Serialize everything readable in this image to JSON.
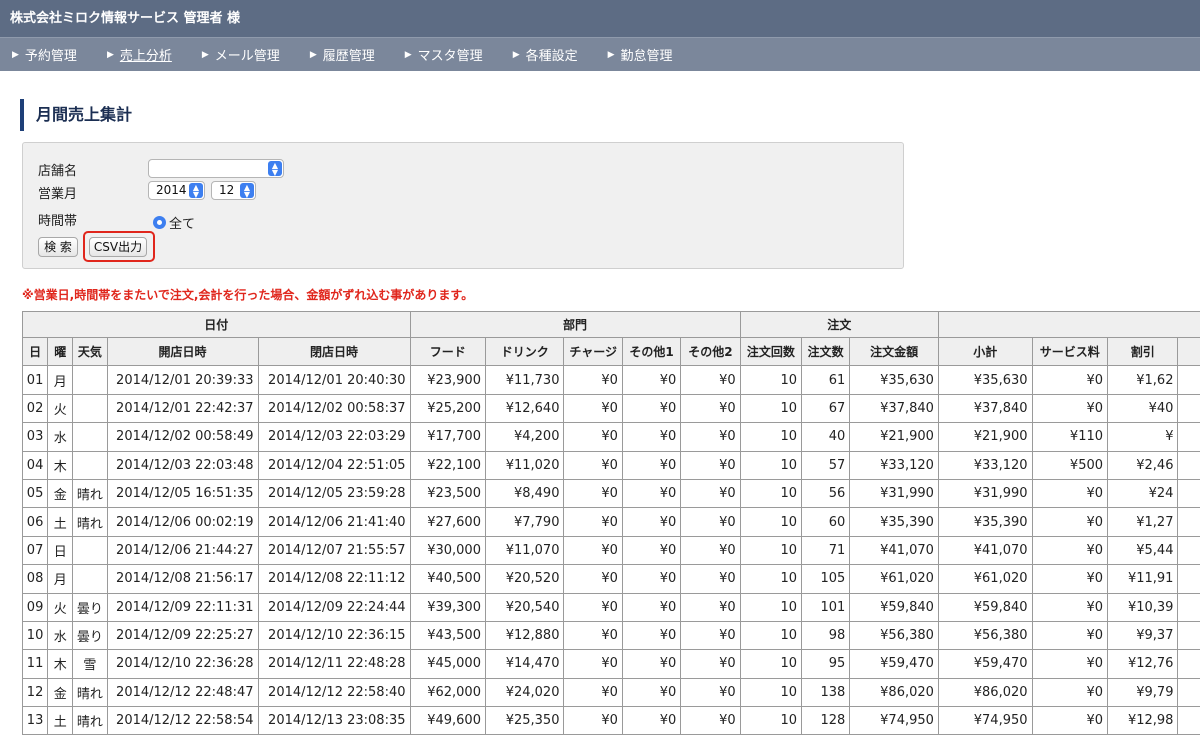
{
  "header": {
    "title": "株式会社ミロク情報サービス 管理者 様"
  },
  "nav": [
    {
      "label": "予約管理"
    },
    {
      "label": "売上分析"
    },
    {
      "label": "メール管理"
    },
    {
      "label": "履歴管理"
    },
    {
      "label": "マスタ管理"
    },
    {
      "label": "各種設定"
    },
    {
      "label": "勤怠管理"
    }
  ],
  "page": {
    "title": "月間売上集計"
  },
  "form": {
    "store_label": "店舗名",
    "store_value": "",
    "month_label": "営業月",
    "year_value": "2014",
    "month_value": "12",
    "time_label": "時間帯",
    "time_option": "全て",
    "search_label": "検 索",
    "csv_label": "CSV出力"
  },
  "notice": "※営業日,時間帯をまたいで注文,会計を行った場合、金額がずれ込む事があります。",
  "table": {
    "groups": [
      "日付",
      "部門",
      "注文"
    ],
    "columns": [
      "日",
      "曜",
      "天気",
      "開店日時",
      "閉店日時",
      "フード",
      "ドリンク",
      "チャージ",
      "その他1",
      "その他2",
      "注文回数",
      "注文数",
      "注文金額",
      "小計",
      "サービス料",
      "割引"
    ],
    "rows": [
      [
        "01",
        "月",
        "",
        "2014/12/01 20:39:33",
        "2014/12/01 20:40:30",
        "¥23,900",
        "¥11,730",
        "¥0",
        "¥0",
        "¥0",
        "10",
        "61",
        "¥35,630",
        "¥35,630",
        "¥0",
        "¥1,62"
      ],
      [
        "02",
        "火",
        "",
        "2014/12/01 22:42:37",
        "2014/12/02 00:58:37",
        "¥25,200",
        "¥12,640",
        "¥0",
        "¥0",
        "¥0",
        "10",
        "67",
        "¥37,840",
        "¥37,840",
        "¥0",
        "¥40"
      ],
      [
        "03",
        "水",
        "",
        "2014/12/02 00:58:49",
        "2014/12/03 22:03:29",
        "¥17,700",
        "¥4,200",
        "¥0",
        "¥0",
        "¥0",
        "10",
        "40",
        "¥21,900",
        "¥21,900",
        "¥110",
        "¥"
      ],
      [
        "04",
        "木",
        "",
        "2014/12/03 22:03:48",
        "2014/12/04 22:51:05",
        "¥22,100",
        "¥11,020",
        "¥0",
        "¥0",
        "¥0",
        "10",
        "57",
        "¥33,120",
        "¥33,120",
        "¥500",
        "¥2,46"
      ],
      [
        "05",
        "金",
        "晴れ",
        "2014/12/05 16:51:35",
        "2014/12/05 23:59:28",
        "¥23,500",
        "¥8,490",
        "¥0",
        "¥0",
        "¥0",
        "10",
        "56",
        "¥31,990",
        "¥31,990",
        "¥0",
        "¥24"
      ],
      [
        "06",
        "土",
        "晴れ",
        "2014/12/06 00:02:19",
        "2014/12/06 21:41:40",
        "¥27,600",
        "¥7,790",
        "¥0",
        "¥0",
        "¥0",
        "10",
        "60",
        "¥35,390",
        "¥35,390",
        "¥0",
        "¥1,27"
      ],
      [
        "07",
        "日",
        "",
        "2014/12/06 21:44:27",
        "2014/12/07 21:55:57",
        "¥30,000",
        "¥11,070",
        "¥0",
        "¥0",
        "¥0",
        "10",
        "71",
        "¥41,070",
        "¥41,070",
        "¥0",
        "¥5,44"
      ],
      [
        "08",
        "月",
        "",
        "2014/12/08 21:56:17",
        "2014/12/08 22:11:12",
        "¥40,500",
        "¥20,520",
        "¥0",
        "¥0",
        "¥0",
        "10",
        "105",
        "¥61,020",
        "¥61,020",
        "¥0",
        "¥11,91"
      ],
      [
        "09",
        "火",
        "曇り",
        "2014/12/09 22:11:31",
        "2014/12/09 22:24:44",
        "¥39,300",
        "¥20,540",
        "¥0",
        "¥0",
        "¥0",
        "10",
        "101",
        "¥59,840",
        "¥59,840",
        "¥0",
        "¥10,39"
      ],
      [
        "10",
        "水",
        "曇り",
        "2014/12/09 22:25:27",
        "2014/12/10 22:36:15",
        "¥43,500",
        "¥12,880",
        "¥0",
        "¥0",
        "¥0",
        "10",
        "98",
        "¥56,380",
        "¥56,380",
        "¥0",
        "¥9,37"
      ],
      [
        "11",
        "木",
        "雪",
        "2014/12/10 22:36:28",
        "2014/12/11 22:48:28",
        "¥45,000",
        "¥14,470",
        "¥0",
        "¥0",
        "¥0",
        "10",
        "95",
        "¥59,470",
        "¥59,470",
        "¥0",
        "¥12,76"
      ],
      [
        "12",
        "金",
        "晴れ",
        "2014/12/12 22:48:47",
        "2014/12/12 22:58:40",
        "¥62,000",
        "¥24,020",
        "¥0",
        "¥0",
        "¥0",
        "10",
        "138",
        "¥86,020",
        "¥86,020",
        "¥0",
        "¥9,79"
      ],
      [
        "13",
        "土",
        "晴れ",
        "2014/12/12 22:58:54",
        "2014/12/13 23:08:35",
        "¥49,600",
        "¥25,350",
        "¥0",
        "¥0",
        "¥0",
        "10",
        "128",
        "¥74,950",
        "¥74,950",
        "¥0",
        "¥12,98"
      ]
    ]
  },
  "colors": {
    "topbar": "#5d6c84",
    "navbar": "#7b879b",
    "accent": "#1e3f78",
    "highlight": "#e0261c",
    "control": "#3d7ff0"
  }
}
